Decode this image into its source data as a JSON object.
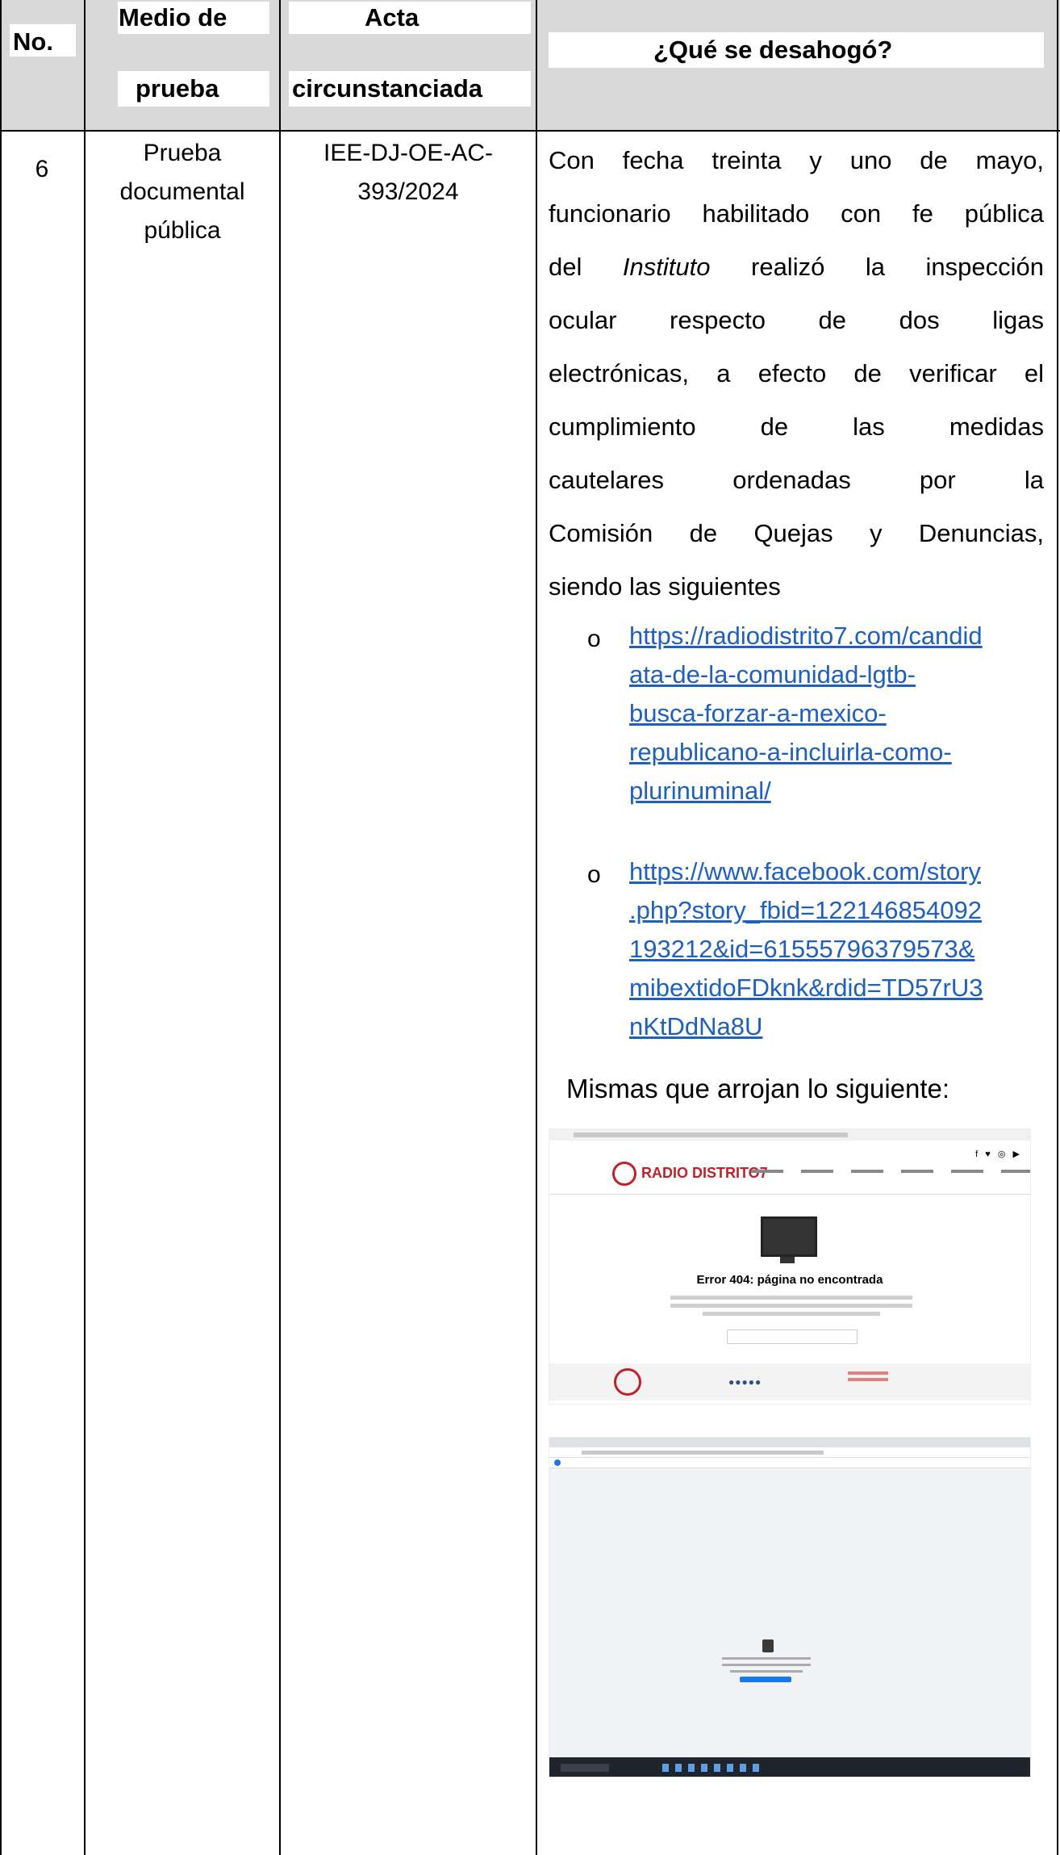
{
  "header": {
    "no": "No.",
    "medio_line1": "Medio de",
    "medio_line2": "prueba",
    "acta_line1": "Acta",
    "acta_line2": "circunstanciada",
    "que": "¿Qué se desahogó?"
  },
  "row": {
    "no": "6",
    "medio": [
      "Prueba",
      "documental",
      "pública"
    ],
    "acta": [
      "IEE-DJ-OE-AC-",
      "393/2024"
    ],
    "text_lines": [
      "Con fecha treinta y uno de mayo,",
      "funcionario habilitado con fe pública",
      "del",
      "ocular respecto de dos ligas",
      "electrónicas, a efecto de verificar el",
      "cumplimiento de las medidas",
      "cautelares ordenadas por la",
      "Comisión de Quejas y Denuncias,",
      "siendo las siguientes"
    ],
    "instituto_word": "Instituto",
    "line3_rest": "realizó la inspección",
    "bullet_glyph": "o",
    "link1_lines": [
      "https://radiodistrito7.com/candid",
      "ata-de-la-comunidad-lgtb-",
      "busca-forzar-a-mexico-",
      "republicano-a-incluirla-como-",
      "plurinuminal/"
    ],
    "link2_lines": [
      "https://www.facebook.com/story",
      ".php?story_fbid=122146854092",
      "193212&id=61555796379573&",
      "mibextidoFDknk&rdid=TD57rU3",
      "nKtDdNa8U"
    ],
    "caption": "Mismas que arrojan lo siguiente:"
  },
  "screenshot1": {
    "logo_text": "RADIO DISTRITO7",
    "error_text": "Error 404: página no encontrada",
    "social": "f ♥ ◎ ▶",
    "footer_dots": "●●●●●"
  },
  "colors": {
    "link": "#1f5fbf",
    "header_bg": "#d9d9d9",
    "logo_red": "#c0202a",
    "facebook_blue": "#1877f2"
  }
}
